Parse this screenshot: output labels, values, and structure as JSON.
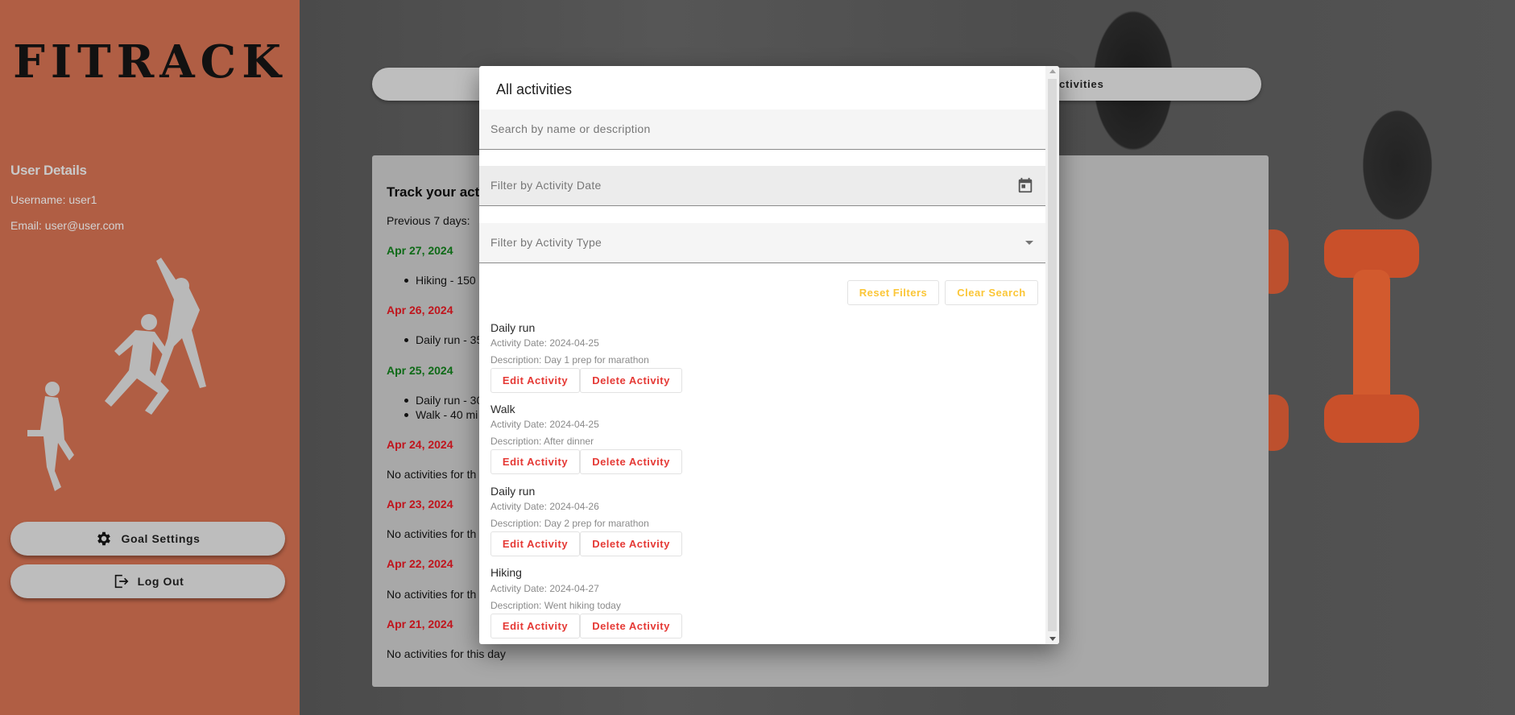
{
  "app": {
    "logo": "FITRACK"
  },
  "sidebar": {
    "user_details_title": "User Details",
    "username": "Username: user1",
    "email": "Email: user@user.com",
    "goal_settings_label": "Goal Settings",
    "logout_label": "Log Out"
  },
  "header": {
    "tab_label": "ctivities"
  },
  "tracker": {
    "title": "Track your activ",
    "previous_label": "Previous 7 days:",
    "days": [
      {
        "date": "Apr 27, 2024",
        "status": "met",
        "items": [
          "Hiking - 150"
        ]
      },
      {
        "date": "Apr 26, 2024",
        "status": "missed",
        "items": [
          "Daily run - 35"
        ]
      },
      {
        "date": "Apr 25, 2024",
        "status": "met",
        "items": [
          "Daily run - 30",
          "Walk - 40 mi"
        ]
      },
      {
        "date": "Apr 24, 2024",
        "status": "missed",
        "empty": "No activities for th"
      },
      {
        "date": "Apr 23, 2024",
        "status": "missed",
        "empty": "No activities for th"
      },
      {
        "date": "Apr 22, 2024",
        "status": "missed",
        "empty": "No activities for th"
      },
      {
        "date": "Apr 21, 2024",
        "status": "missed",
        "empty": "No activities for this day"
      }
    ]
  },
  "modal": {
    "title": "All activities",
    "search_placeholder": "Search by name or description",
    "date_filter_placeholder": "Filter by Activity Date",
    "type_filter_placeholder": "Filter by Activity Type",
    "reset_filters_label": "Reset Filters",
    "clear_search_label": "Clear Search",
    "edit_label": "Edit Activity",
    "delete_label": "Delete Activity",
    "activities": [
      {
        "name": "Daily run",
        "date": "Activity Date: 2024-04-25",
        "description": "Description: Day 1 prep for marathon"
      },
      {
        "name": "Walk",
        "date": "Activity Date: 2024-04-25",
        "description": "Description: After dinner"
      },
      {
        "name": "Daily run",
        "date": "Activity Date: 2024-04-26",
        "description": "Description: Day 2 prep for marathon"
      },
      {
        "name": "Hiking",
        "date": "Activity Date: 2024-04-27",
        "description": "Description: Went hiking today"
      }
    ]
  },
  "colors": {
    "sidebar": "#b05e44",
    "met_day": "#0e6a17",
    "missed_day": "#c0151d",
    "accent_yellow": "#fbc637",
    "accent_red": "#e53935"
  },
  "icons": [
    "gear-icon",
    "logout-icon",
    "calendar-icon",
    "dropdown-arrow-icon"
  ]
}
